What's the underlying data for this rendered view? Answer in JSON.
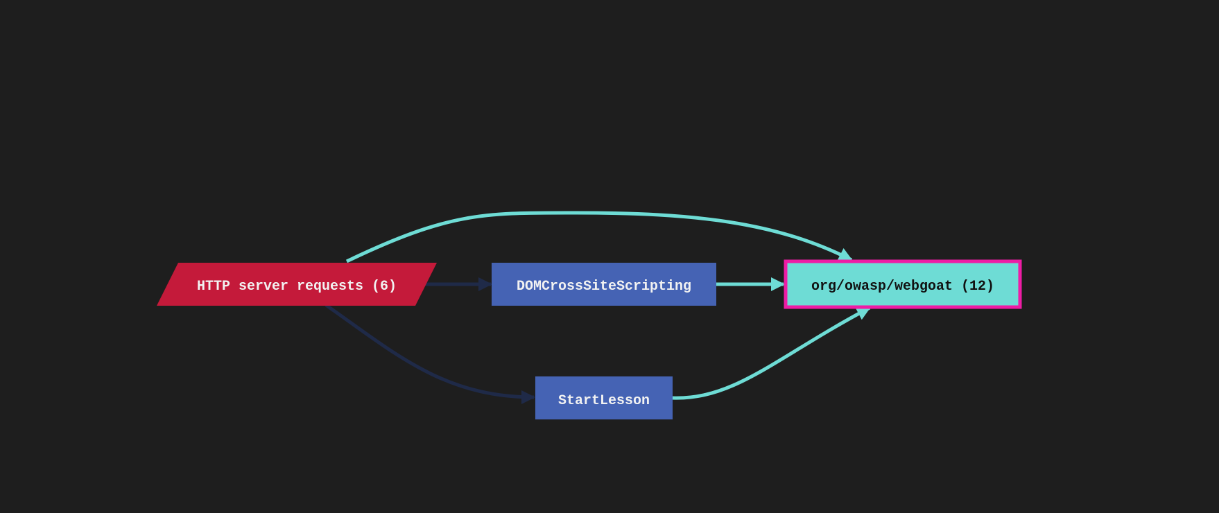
{
  "nodes": {
    "http": {
      "label": "HTTP server requests (6)",
      "color": "#c41a3a",
      "text_color": "#f2f2f2"
    },
    "dom": {
      "label": "DOMCrossSiteScripting",
      "color": "#4563b4",
      "text_color": "#f2f2f2"
    },
    "start": {
      "label": "StartLesson",
      "color": "#4563b4",
      "text_color": "#f2f2f2"
    },
    "webgoat": {
      "label": "org/owasp/webgoat (12)",
      "color": "#6edcd5",
      "text_color": "#111111",
      "border_color": "#ee1ca5"
    }
  },
  "colors": {
    "background": "#1e1e1e",
    "edge_highlight": "#6edcd5",
    "edge_dim": "#1f2a48"
  }
}
